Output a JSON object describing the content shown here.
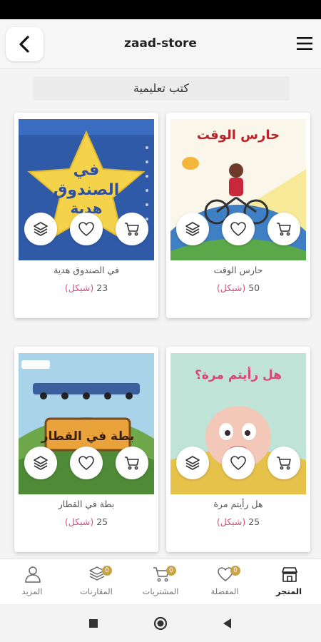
{
  "header": {
    "title": "zaad-store"
  },
  "category": {
    "title": "كتب تعليمية"
  },
  "products": [
    {
      "title": "في الصندوق هدية",
      "price": "23",
      "currency": "(شيكل)",
      "cover": {
        "line1": "في",
        "line2": "الصندوق",
        "line3": "هدية"
      },
      "actions": {
        "compare": "layers-icon",
        "favorite": "heart-icon",
        "cart": "cart-icon"
      }
    },
    {
      "title": "حارس الوقت",
      "price": "50",
      "currency": "(شيكل)",
      "cover": {
        "line1": "حارس الوقت"
      },
      "actions": {
        "compare": "layers-icon",
        "favorite": "heart-icon",
        "cart": "cart-icon"
      }
    },
    {
      "title": "بطة في القطار",
      "price": "25",
      "currency": "(شيكل)",
      "cover": {
        "line1": "بطة في القطار"
      },
      "actions": {
        "compare": "layers-icon",
        "favorite": "heart-icon",
        "cart": "cart-icon"
      }
    },
    {
      "title": "هل رأيتم مرة",
      "price": "25",
      "currency": "(شيكل)",
      "cover": {
        "line1": "هل رأيتم مرة؟"
      },
      "actions": {
        "compare": "layers-icon",
        "favorite": "heart-icon",
        "cart": "cart-icon"
      }
    }
  ],
  "bottom_nav": [
    {
      "label": "المزيد",
      "icon": "person-icon",
      "badge": ""
    },
    {
      "label": "المقارنات",
      "icon": "layers-icon",
      "badge": "0"
    },
    {
      "label": "المشتريات",
      "icon": "cart-icon",
      "badge": "0"
    },
    {
      "label": "المفضلة",
      "icon": "heart-icon",
      "badge": "0"
    },
    {
      "label": "المتجر",
      "icon": "store-icon",
      "badge": "",
      "active": true
    }
  ],
  "colors": {
    "price_currency": "#d0507a",
    "badge": "#c9a34a",
    "accent_dark": "#222222"
  }
}
